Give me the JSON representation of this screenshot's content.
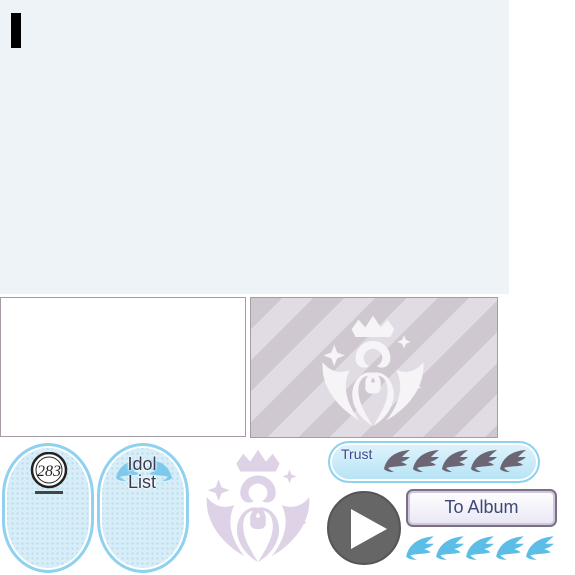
{
  "trust": {
    "label": "Trust",
    "level": 0,
    "max": 5
  },
  "menu": {
    "idol_list_label": "Idol\nList",
    "logo_icon": "production-logo-icon"
  },
  "actions": {
    "to_album_label": "To Album",
    "play_icon": "play-icon"
  },
  "wings": {
    "count": 5,
    "icon": "wing-icon"
  },
  "emblem": {
    "icon": "swan-crown-emblem-icon"
  },
  "colors": {
    "panel_bg": "#edf3f7",
    "frame_border": "#a89ba8",
    "pill_border": "#8fd1ef",
    "wing_blue": "#5cbde6",
    "wing_grey": "#6c6573",
    "play_bg": "#666666"
  }
}
